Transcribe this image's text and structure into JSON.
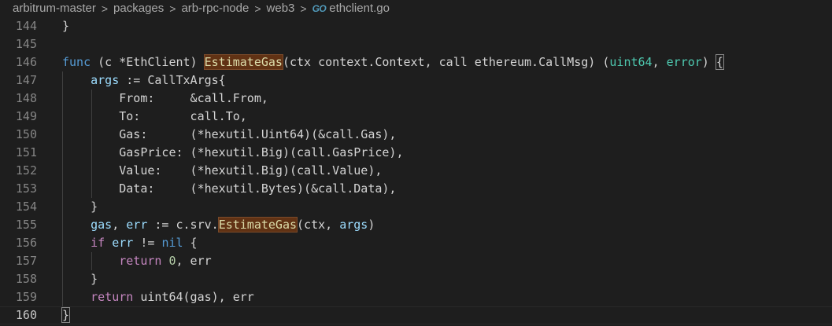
{
  "breadcrumb": {
    "items": [
      "arbitrum-master",
      "packages",
      "arb-rpc-node",
      "web3"
    ],
    "separator": ">",
    "file_icon": "GO",
    "file_name": "ethclient.go"
  },
  "colors": {
    "background": "#1e1e1e",
    "keyword": "#569cd6",
    "function": "#dcdcaa",
    "variable": "#9cdcfe",
    "type": "#4ec9b0",
    "number": "#b5cea8",
    "highlight": "#613214"
  },
  "editor": {
    "language": "go",
    "current_line": 160,
    "lines": [
      {
        "n": "144",
        "text": "}"
      },
      {
        "n": "145",
        "text": ""
      },
      {
        "n": "146",
        "text": "func (c *EthClient) EstimateGas(ctx context.Context, call ethereum.CallMsg) (uint64, error) {"
      },
      {
        "n": "147",
        "text": "    args := CallTxArgs{"
      },
      {
        "n": "148",
        "text": "        From:     &call.From,"
      },
      {
        "n": "149",
        "text": "        To:       call.To,"
      },
      {
        "n": "150",
        "text": "        Gas:      (*hexutil.Uint64)(&call.Gas),"
      },
      {
        "n": "151",
        "text": "        GasPrice: (*hexutil.Big)(call.GasPrice),"
      },
      {
        "n": "152",
        "text": "        Value:    (*hexutil.Big)(call.Value),"
      },
      {
        "n": "153",
        "text": "        Data:     (*hexutil.Bytes)(&call.Data),"
      },
      {
        "n": "154",
        "text": "    }"
      },
      {
        "n": "155",
        "text": "    gas, err := c.srv.EstimateGas(ctx, args)"
      },
      {
        "n": "156",
        "text": "    if err != nil {"
      },
      {
        "n": "157",
        "text": "        return 0, err"
      },
      {
        "n": "158",
        "text": "    }"
      },
      {
        "n": "159",
        "text": "    return uint64(gas), err"
      },
      {
        "n": "160",
        "text": "}"
      }
    ]
  }
}
